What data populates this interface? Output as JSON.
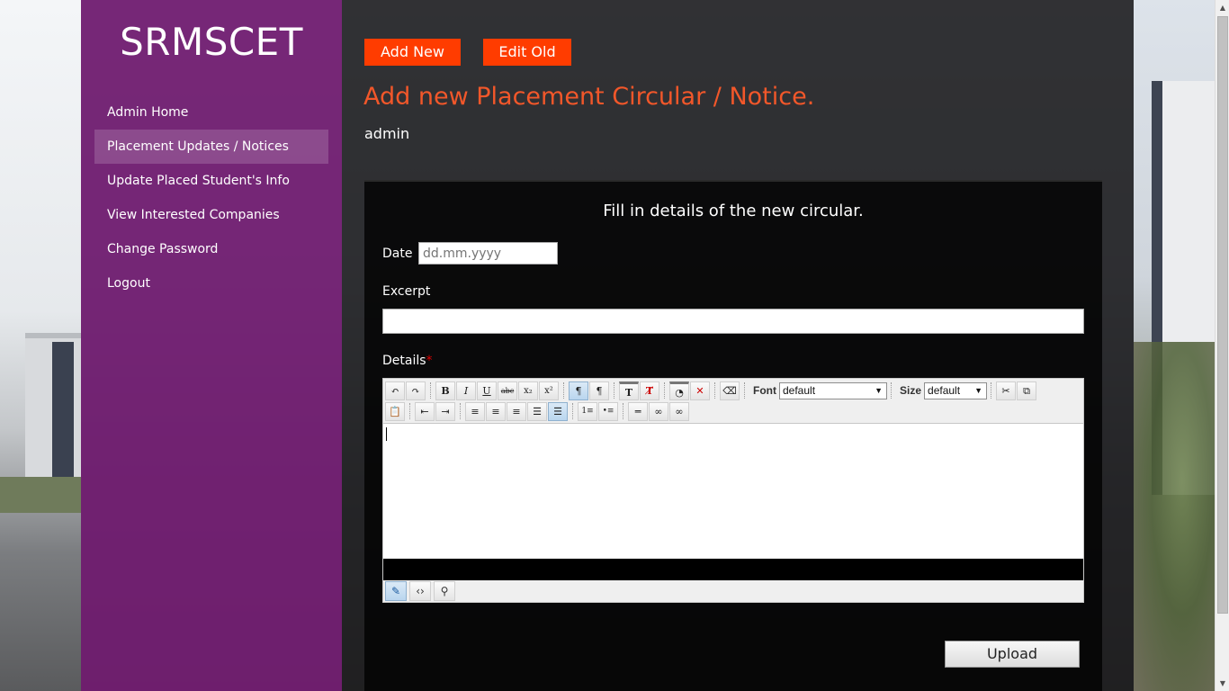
{
  "brand": "SRMSCET",
  "nav": {
    "items": [
      {
        "label": "Admin Home"
      },
      {
        "label": "Placement Updates / Notices"
      },
      {
        "label": "Update Placed Student's Info"
      },
      {
        "label": "View Interested Companies"
      },
      {
        "label": "Change Password"
      },
      {
        "label": "Logout"
      }
    ],
    "active_index": 1
  },
  "actions": {
    "add_new": "Add New",
    "edit_old": "Edit Old"
  },
  "page": {
    "title": "Add new Placement Circular / Notice.",
    "user": "admin"
  },
  "form": {
    "heading": "Fill in details of the new circular.",
    "date_label": "Date",
    "date_placeholder": "dd.mm.yyyy",
    "excerpt_label": "Excerpt",
    "details_label": "Details",
    "required_mark": "*",
    "upload_label": "Upload"
  },
  "editor": {
    "font_label": "Font",
    "font_value": "default",
    "size_label": "Size",
    "size_value": "default",
    "toolbar_row1_icons": [
      "undo-icon",
      "redo-icon",
      "bold-icon",
      "italic-icon",
      "underline-icon",
      "strikethrough-icon",
      "subscript-icon",
      "superscript-icon",
      "ltr-icon",
      "rtl-icon",
      "text-color-icon",
      "remove-format-icon",
      "highlight-color-icon",
      "remove-highlight-icon",
      "eraser-icon",
      "cut-icon",
      "copy-icon"
    ],
    "toolbar_row2_icons": [
      "paste-icon",
      "outdent-icon",
      "indent-icon",
      "align-left-icon",
      "align-center-icon",
      "align-right-icon",
      "justify-icon",
      "justify-full-icon",
      "ordered-list-icon",
      "unordered-list-icon",
      "horizontal-rule-icon",
      "link-icon",
      "unlink-icon"
    ],
    "mode_icons": [
      "design-mode-icon",
      "html-mode-icon",
      "preview-mode-icon"
    ]
  },
  "colors": {
    "sidebar": "#6e196e",
    "accent": "#ff3c00",
    "title": "#f2572a"
  }
}
